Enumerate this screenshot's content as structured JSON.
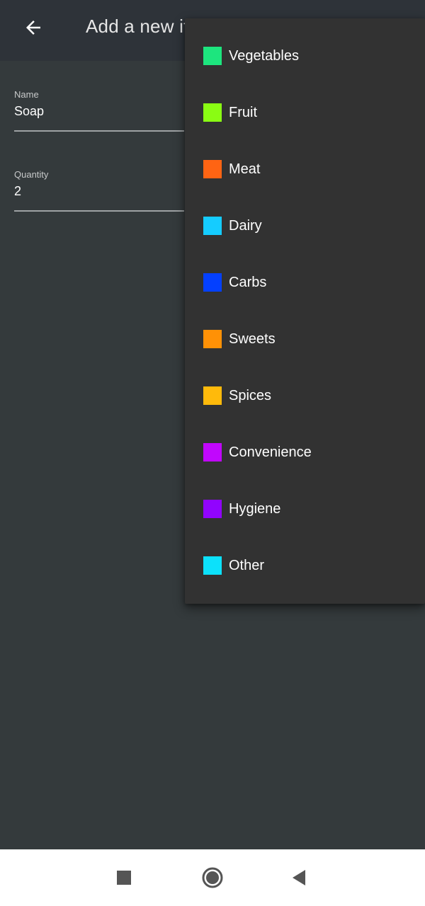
{
  "app_bar": {
    "title": "Add a new item",
    "back_icon": "arrow-left-icon"
  },
  "form": {
    "name": {
      "label": "Name",
      "value": "Soap"
    },
    "quantity": {
      "label": "Quantity",
      "value": "2"
    }
  },
  "category_menu": {
    "items": [
      {
        "label": "Vegetables",
        "color": "#1de57e"
      },
      {
        "label": "Fruit",
        "color": "#8afc13"
      },
      {
        "label": "Meat",
        "color": "#ff6413"
      },
      {
        "label": "Dairy",
        "color": "#15ccff"
      },
      {
        "label": "Carbs",
        "color": "#0440ff"
      },
      {
        "label": "Sweets",
        "color": "#ff9106"
      },
      {
        "label": "Spices",
        "color": "#ffba0b"
      },
      {
        "label": "Convenience",
        "color": "#c107fd"
      },
      {
        "label": "Hygiene",
        "color": "#9104fe"
      },
      {
        "label": "Other",
        "color": "#0ce1fb"
      }
    ]
  },
  "nav_bar": {
    "recents_icon": "square-icon",
    "home_icon": "circle-icon",
    "back_icon": "triangle-back-icon"
  }
}
